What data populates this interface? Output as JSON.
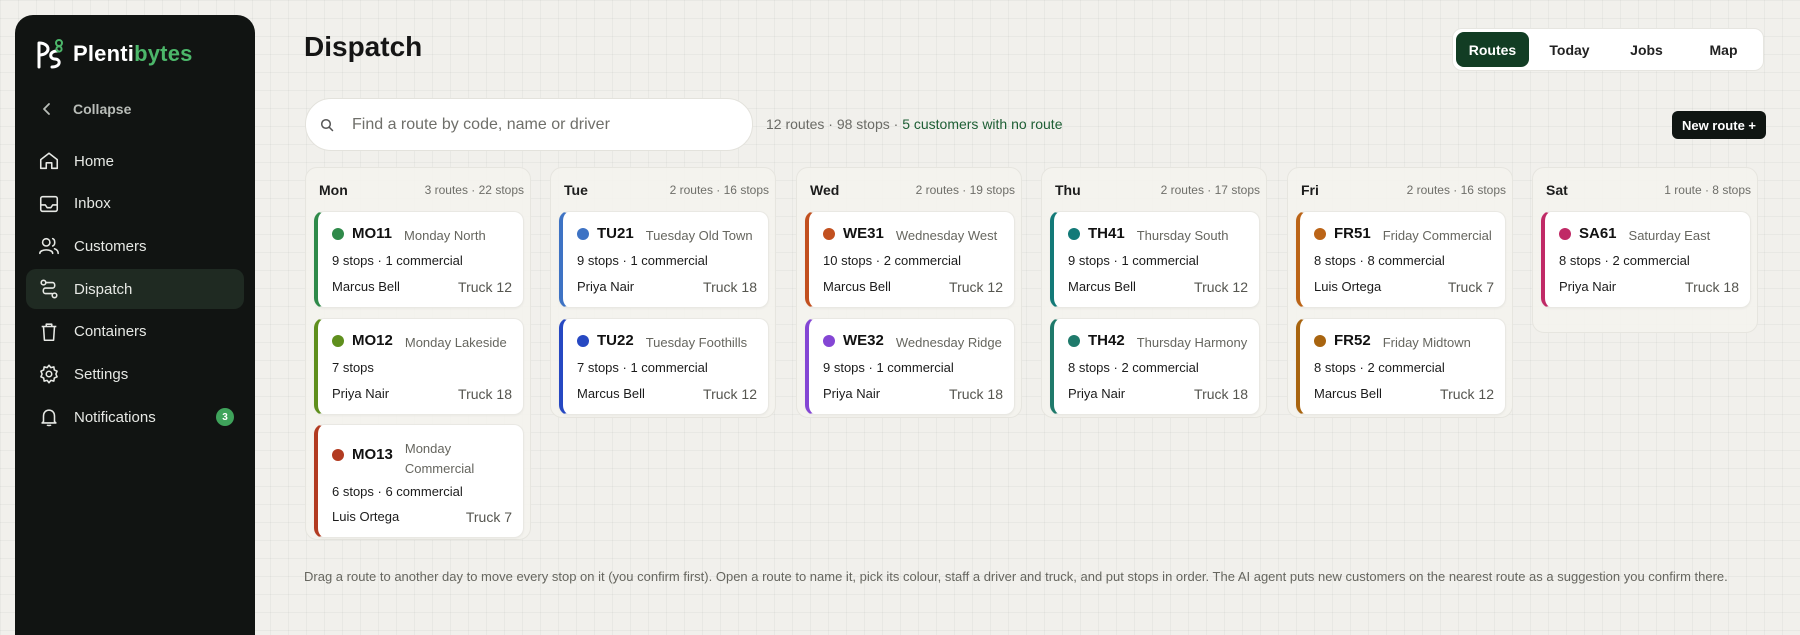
{
  "brand": {
    "name_part1": "Plenti",
    "name_part2": "bytes"
  },
  "sidebar": {
    "collapse_label": "Collapse",
    "items": [
      {
        "label": "Home",
        "icon": "home-icon"
      },
      {
        "label": "Inbox",
        "icon": "inbox-icon"
      },
      {
        "label": "Customers",
        "icon": "users-icon"
      },
      {
        "label": "Dispatch",
        "icon": "route-icon",
        "active": true
      },
      {
        "label": "Containers",
        "icon": "trash-bin-icon"
      },
      {
        "label": "Settings",
        "icon": "gear-icon"
      },
      {
        "label": "Notifications",
        "icon": "bell-icon",
        "badge": "3"
      }
    ]
  },
  "header": {
    "title": "Dispatch"
  },
  "view_tabs": [
    {
      "label": "Routes",
      "active": true
    },
    {
      "label": "Today"
    },
    {
      "label": "Jobs"
    },
    {
      "label": "Map"
    }
  ],
  "search": {
    "placeholder": "Find a route by code, name or driver"
  },
  "summary": {
    "text": "12 routes · 98 stops · ",
    "highlight": "5 customers with no route"
  },
  "new_route_label": "New route +",
  "days": [
    {
      "name": "Mon",
      "meta": "3 routes · 22 stops",
      "routes": [
        {
          "code": "MO11",
          "name": "Monday North",
          "stops": "9 stops · 1 commercial",
          "driver": "Marcus Bell",
          "truck": "Truck 12",
          "color": "#2f8a4a"
        },
        {
          "code": "MO12",
          "name": "Monday Lakeside",
          "stops": "7 stops",
          "driver": "Priya Nair",
          "truck": "Truck 18",
          "color": "#5f8f1d"
        },
        {
          "code": "MO13",
          "name": "Monday Commercial",
          "stops": "6 stops · 6 commercial",
          "driver": "Luis Ortega",
          "truck": "Truck 7",
          "color": "#b23b21"
        }
      ]
    },
    {
      "name": "Tue",
      "meta": "2 routes · 16 stops",
      "routes": [
        {
          "code": "TU21",
          "name": "Tuesday Old Town",
          "stops": "9 stops · 1 commercial",
          "driver": "Priya Nair",
          "truck": "Truck 18",
          "color": "#3e73c4"
        },
        {
          "code": "TU22",
          "name": "Tuesday Foothills",
          "stops": "7 stops · 1 commercial",
          "driver": "Marcus Bell",
          "truck": "Truck 12",
          "color": "#2648c2"
        }
      ]
    },
    {
      "name": "Wed",
      "meta": "2 routes · 19 stops",
      "routes": [
        {
          "code": "WE31",
          "name": "Wednesday West",
          "stops": "10 stops · 2 commercial",
          "driver": "Marcus Bell",
          "truck": "Truck 12",
          "color": "#c2501f"
        },
        {
          "code": "WE32",
          "name": "Wednesday Ridge",
          "stops": "9 stops · 1 commercial",
          "driver": "Priya Nair",
          "truck": "Truck 18",
          "color": "#8446d4"
        }
      ]
    },
    {
      "name": "Thu",
      "meta": "2 routes · 17 stops",
      "routes": [
        {
          "code": "TH41",
          "name": "Thursday South",
          "stops": "9 stops · 1 commercial",
          "driver": "Marcus Bell",
          "truck": "Truck 12",
          "color": "#137a78"
        },
        {
          "code": "TH42",
          "name": "Thursday Harmony",
          "stops": "8 stops · 2 commercial",
          "driver": "Priya Nair",
          "truck": "Truck 18",
          "color": "#1f7a6b"
        }
      ]
    },
    {
      "name": "Fri",
      "meta": "2 routes · 16 stops",
      "routes": [
        {
          "code": "FR51",
          "name": "Friday Commercial",
          "stops": "8 stops · 8 commercial",
          "driver": "Luis Ortega",
          "truck": "Truck 7",
          "color": "#bb6417"
        },
        {
          "code": "FR52",
          "name": "Friday Midtown",
          "stops": "8 stops · 2 commercial",
          "driver": "Marcus Bell",
          "truck": "Truck 12",
          "color": "#a8640f"
        }
      ]
    },
    {
      "name": "Sat",
      "meta": "1 route · 8 stops",
      "routes": [
        {
          "code": "SA61",
          "name": "Saturday East",
          "stops": "8 stops · 2 commercial",
          "driver": "Priya Nair",
          "truck": "Truck 18",
          "color": "#c02a66"
        }
      ]
    }
  ],
  "footnote": "Drag a route to another day to move every stop on it (you confirm first). Open a route to name it, pick its colour, staff a driver and truck, and put stops in order. The AI agent puts new customers on the nearest route as a suggestion you confirm there."
}
